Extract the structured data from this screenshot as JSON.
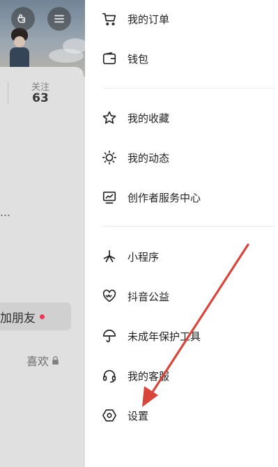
{
  "profile": {
    "follow_label": "关注",
    "follow_count": "63",
    "truncated_text": "…",
    "add_friend_label": "加朋友",
    "likes_label": "喜欢"
  },
  "drawer": {
    "group1": [
      {
        "icon": "cart-icon",
        "label": "我的订单"
      },
      {
        "icon": "wallet-icon",
        "label": "钱包"
      }
    ],
    "group2": [
      {
        "icon": "star-icon",
        "label": "我的收藏"
      },
      {
        "icon": "activity-icon",
        "label": "我的动态"
      },
      {
        "icon": "creator-monitor-icon",
        "label": "创作者服务中心"
      }
    ],
    "group3": [
      {
        "icon": "mini-program-icon",
        "label": "小程序"
      },
      {
        "icon": "heart-charity-icon",
        "label": "抖音公益"
      },
      {
        "icon": "umbrella-icon",
        "label": "未成年保护工具"
      },
      {
        "icon": "headset-icon",
        "label": "我的客服"
      },
      {
        "icon": "settings-hexagon-icon",
        "label": "设置"
      }
    ]
  },
  "annotation": {
    "arrow_color": "#d8453a"
  }
}
